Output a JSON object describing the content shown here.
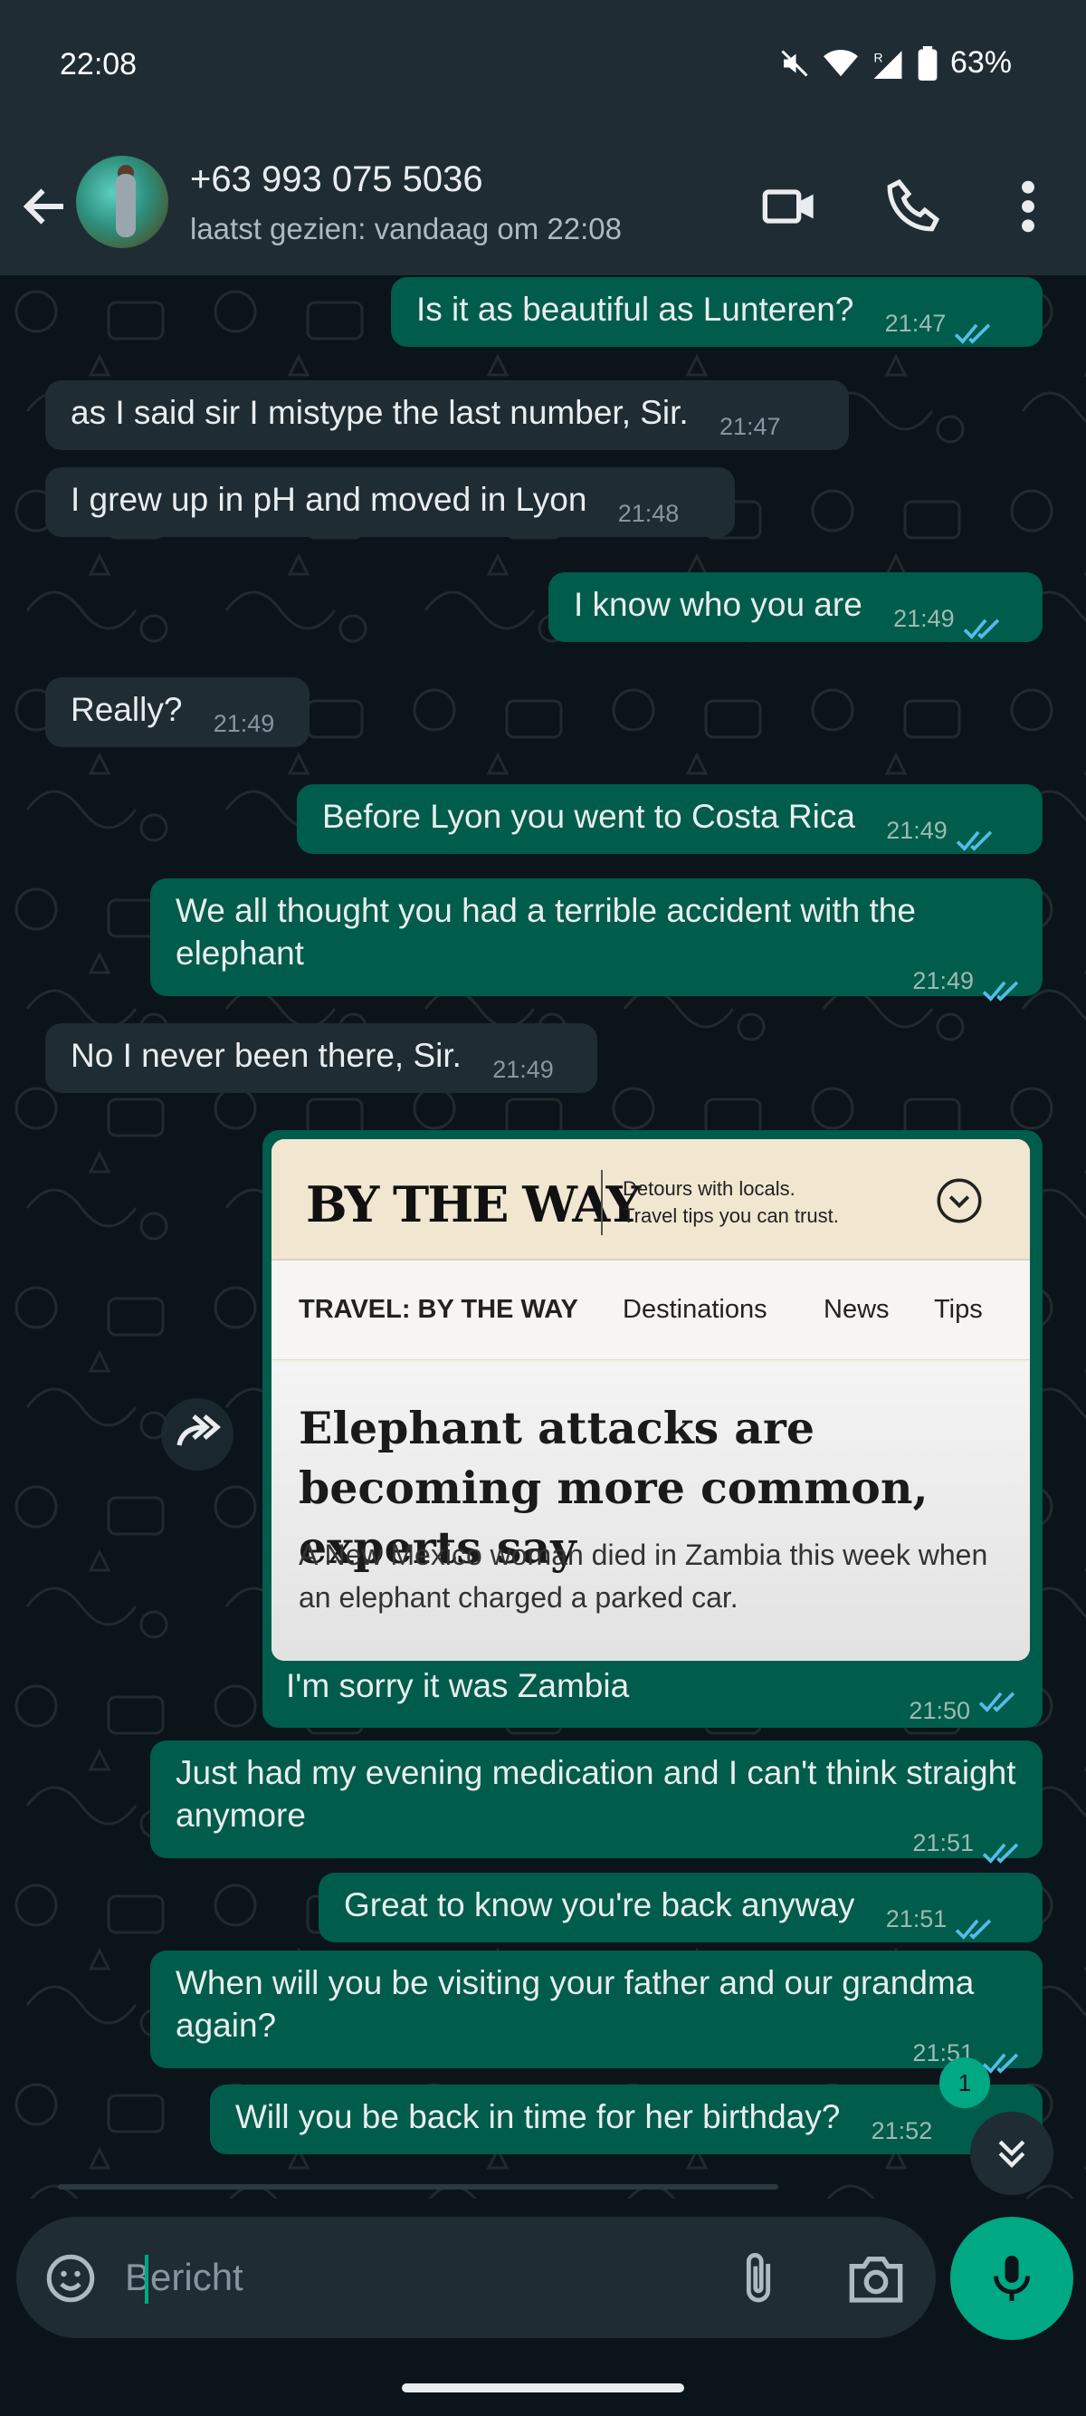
{
  "status_bar": {
    "time": "22:08",
    "battery": "63%"
  },
  "header": {
    "contact": "+63 993 075 5036",
    "last_seen": "laatst gezien: vandaag om 22:08"
  },
  "messages": [
    {
      "dir": "out",
      "text": "Is it as beautiful as Lunteren?",
      "time": "21:47"
    },
    {
      "dir": "in",
      "text": "as I said sir I mistype the last number, Sir.",
      "time": "21:47"
    },
    {
      "dir": "in",
      "text": "I grew up in pH and moved in Lyon",
      "time": "21:48"
    },
    {
      "dir": "out",
      "text": "I know who you are",
      "time": "21:49"
    },
    {
      "dir": "in",
      "text": "Really?",
      "time": "21:49"
    },
    {
      "dir": "out",
      "text": "Before Lyon you went to Costa Rica",
      "time": "21:49"
    },
    {
      "dir": "out",
      "text": "We all thought you had a terrible accident with the elephant",
      "time": "21:49"
    },
    {
      "dir": "in",
      "text": "No I never been there, Sir.",
      "time": "21:49"
    },
    {
      "dir": "out",
      "text": "I'm sorry it was Zambia",
      "time": "21:50"
    },
    {
      "dir": "out",
      "text": "Just had my evening medication and I can't think straight anymore",
      "time": "21:51"
    },
    {
      "dir": "out",
      "text": "Great to know you're back anyway",
      "time": "21:51"
    },
    {
      "dir": "out",
      "text": "When will you be visiting your father and our grandma again?",
      "time": "21:51"
    },
    {
      "dir": "out",
      "text": "Will you be back in time for her birthday?",
      "time": "21:52"
    }
  ],
  "preview": {
    "logo": "BY THE WAY",
    "tagline_1": "Detours with locals.",
    "tagline_2": "Travel tips you can trust.",
    "nav": [
      "TRAVEL: BY THE WAY",
      "Destinations",
      "News",
      "Tips"
    ],
    "headline": "Elephant attacks are becoming more common, experts say",
    "subtitle": "A New Mexico woman died in Zambia this week when an elephant charged a parked car."
  },
  "unread_count": "1",
  "composer": {
    "placeholder": "Bericht"
  },
  "colors": {
    "accent": "#00a884",
    "outgoing": "#005c4b",
    "incoming": "#1f2c34",
    "background": "#0b141a"
  }
}
